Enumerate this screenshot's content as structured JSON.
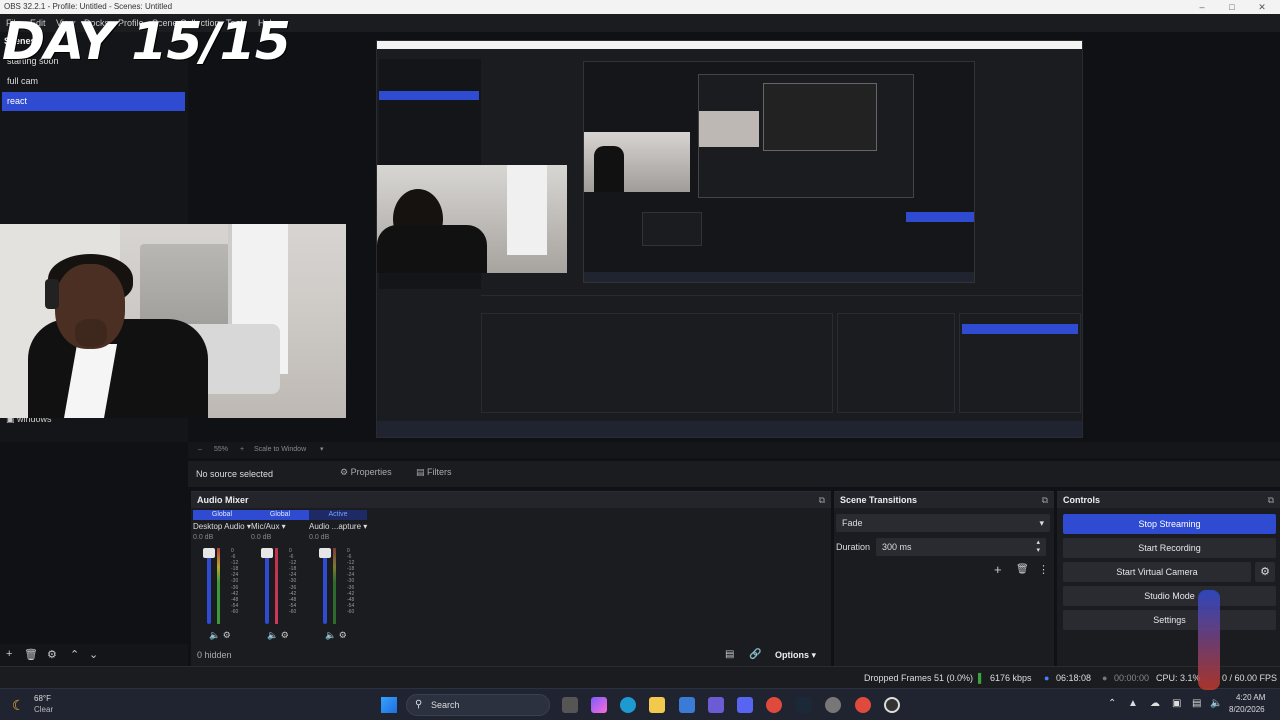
{
  "window": {
    "title": "OBS 32.2.1 - Profile: Untitled - Scenes: Untitled"
  },
  "menu": [
    "File",
    "Edit",
    "View",
    "Docks",
    "Profile",
    "Scene Collection",
    "Tools",
    "Help"
  ],
  "overlay": {
    "text": "DAY 15/15"
  },
  "scenes": {
    "title": "Scenes",
    "items": [
      "starting soon",
      "full cam",
      "react"
    ],
    "selected": "react"
  },
  "sources_visible": {
    "windows_label": "windows"
  },
  "zoom": {
    "value": "55%",
    "mode": "Scale to Window"
  },
  "properties_bar": {
    "no_source": "No source selected",
    "properties": "Properties",
    "filters": "Filters"
  },
  "audio_mixer": {
    "title": "Audio Mixer",
    "channels": [
      {
        "header": "Global",
        "name": "Desktop Audio",
        "db": "0.0 dB",
        "active": false
      },
      {
        "header": "Global",
        "name": "Mic/Aux",
        "db": "0.0 dB",
        "active": false
      },
      {
        "header": "Active",
        "name": "Audio ...apture",
        "db": "0.0 dB",
        "active": true
      }
    ],
    "scale": [
      "0",
      "-6",
      "-12",
      "-18",
      "-24",
      "-30",
      "-36",
      "-42",
      "-48",
      "-54",
      "-60"
    ],
    "hidden": "0 hidden",
    "options": "Options"
  },
  "transitions": {
    "title": "Scene Transitions",
    "transition": "Fade",
    "duration_label": "Duration",
    "duration_value": "300 ms"
  },
  "controls": {
    "title": "Controls",
    "stop_streaming": "Stop Streaming",
    "start_recording": "Start Recording",
    "start_virtual_camera": "Start Virtual Camera",
    "studio_mode": "Studio Mode",
    "settings": "Settings"
  },
  "status": {
    "dropped": "Dropped Frames 51 (0.0%)",
    "bitrate": "6176 kbps",
    "stream_time": "06:18:08",
    "rec_time": "00:00:00",
    "cpu": "CPU: 3.1%",
    "fps": "0 / 60.00 FPS"
  },
  "taskbar": {
    "weather_temp": "68°F",
    "weather_desc": "Clear",
    "search": "Search",
    "time": "4:20 AM",
    "date": "8/20/2026"
  },
  "colors": {
    "accent": "#2f4bd2",
    "panel": "#1b1c20",
    "bg": "#101114"
  }
}
